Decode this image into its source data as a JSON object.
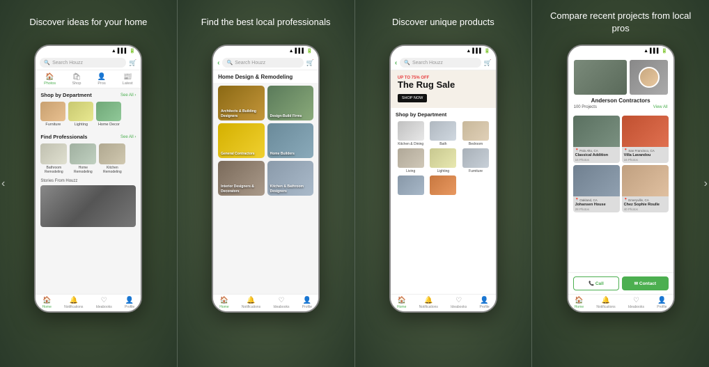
{
  "panels": [
    {
      "id": "panel-1",
      "title": "Discover ideas\nfor your home",
      "phone": {
        "search_placeholder": "Search Houzz",
        "nav_tabs": [
          {
            "label": "Photos",
            "icon": "🏠",
            "active": true
          },
          {
            "label": "Shop",
            "icon": "🛍"
          },
          {
            "label": "Pros",
            "icon": "👤"
          },
          {
            "label": "Latest",
            "icon": "📰"
          }
        ],
        "sections": [
          {
            "title": "Shop by Department",
            "see_all": "See All ›",
            "items": [
              {
                "label": "Furniture",
                "img_class": "img-furniture"
              },
              {
                "label": "Lighting",
                "img_class": "img-lighting"
              },
              {
                "label": "Home Decor",
                "img_class": "img-homedecor"
              }
            ]
          },
          {
            "title": "Find Professionals",
            "see_all": "See All ›",
            "items": [
              {
                "label": "Bathroom\nRemodeling",
                "img_class": "img-bathroom"
              },
              {
                "label": "Home\nRemodeling",
                "img_class": "img-homeremodel"
              },
              {
                "label": "Kitchen\nRemodeling",
                "img_class": "img-kitchen"
              }
            ]
          }
        ],
        "stories_title": "Stories From Houzz",
        "bottom_nav": [
          {
            "label": "Home",
            "icon": "🏠",
            "active": true
          },
          {
            "label": "Notifications",
            "icon": "🔔"
          },
          {
            "label": "Ideabooks",
            "icon": "♡"
          },
          {
            "label": "Profile",
            "icon": "👤"
          }
        ]
      }
    },
    {
      "id": "panel-2",
      "title": "Find the best local\nprofessionals",
      "phone": {
        "search_placeholder": "Search Houzz",
        "has_back": true,
        "section_heading": "Home Design & Remodeling",
        "categories": [
          {
            "label": "Architects &\nBuilding Designers",
            "class": "card-arch"
          },
          {
            "label": "Design-Build Firms",
            "class": "card-design"
          },
          {
            "label": "General Contractors",
            "class": "card-general"
          },
          {
            "label": "Home Builders",
            "class": "card-builders"
          },
          {
            "label": "Interior Designers\n& Decorators",
            "class": "card-interior"
          },
          {
            "label": "Kitchen & Bathroom\nDesigners",
            "class": "card-kitchen"
          }
        ],
        "bottom_nav": [
          {
            "label": "Home",
            "icon": "🏠",
            "active": true
          },
          {
            "label": "Notifications",
            "icon": "🔔"
          },
          {
            "label": "Ideabooks",
            "icon": "♡"
          },
          {
            "label": "Profile",
            "icon": "👤"
          }
        ]
      }
    },
    {
      "id": "panel-3",
      "title": "Discover unique products",
      "phone": {
        "search_placeholder": "Search Houzz",
        "has_back": true,
        "promo": {
          "tag": "UP TO 75% OFF",
          "title": "The Rug\nSale",
          "button": "SHOP NOW"
        },
        "shop_title": "Shop by Department",
        "products": [
          {
            "label": "Kitchen & Dining",
            "class": "prod-kitchen"
          },
          {
            "label": "Bath",
            "class": "prod-bath"
          },
          {
            "label": "Bedroom",
            "class": "prod-bedroom"
          },
          {
            "label": "Living",
            "class": "prod-living"
          },
          {
            "label": "Lighting",
            "class": "prod-lighting"
          },
          {
            "label": "Furniture",
            "class": "prod-furniture"
          },
          {
            "label": "",
            "class": "prod-tiles"
          },
          {
            "label": "",
            "class": "prod-sofa"
          }
        ],
        "bottom_nav": [
          {
            "label": "Home",
            "icon": "🏠",
            "active": true
          },
          {
            "label": "Notifications",
            "icon": "🔔"
          },
          {
            "label": "Ideabooks",
            "icon": "♡"
          },
          {
            "label": "Profile",
            "icon": "👤"
          }
        ]
      }
    },
    {
      "id": "panel-4",
      "title": "Compare recent projects\nfrom local pros",
      "phone": {
        "contractor_name": "Anderson Contractors",
        "projects_count": "100 Projects",
        "view_all": "View All",
        "projects": [
          {
            "title": "Classical Addition",
            "location": "Palo Alto, CA",
            "photos": "16 Photos",
            "class": "proj1"
          },
          {
            "title": "Villa Lavandou",
            "location": "San Francisco, CA",
            "photos": "16 Photos",
            "class": "proj2"
          },
          {
            "title": "Johansen House",
            "location": "Oakland, CA",
            "photos": "28 Photos",
            "class": "proj3"
          },
          {
            "title": "Chez Sophie Roulle",
            "location": "Emeryville, CA",
            "photos": "40 Photos",
            "class": "proj4"
          }
        ],
        "call_label": "📞 Call",
        "contact_label": "✉ Contact",
        "bottom_nav": [
          {
            "label": "Home",
            "icon": "🏠",
            "active": true
          },
          {
            "label": "Notifications",
            "icon": "🔔"
          },
          {
            "label": "Ideabooks",
            "icon": "♡"
          },
          {
            "label": "Profile",
            "icon": "👤"
          }
        ]
      }
    }
  ],
  "scroll_left": "‹",
  "scroll_right": "›"
}
